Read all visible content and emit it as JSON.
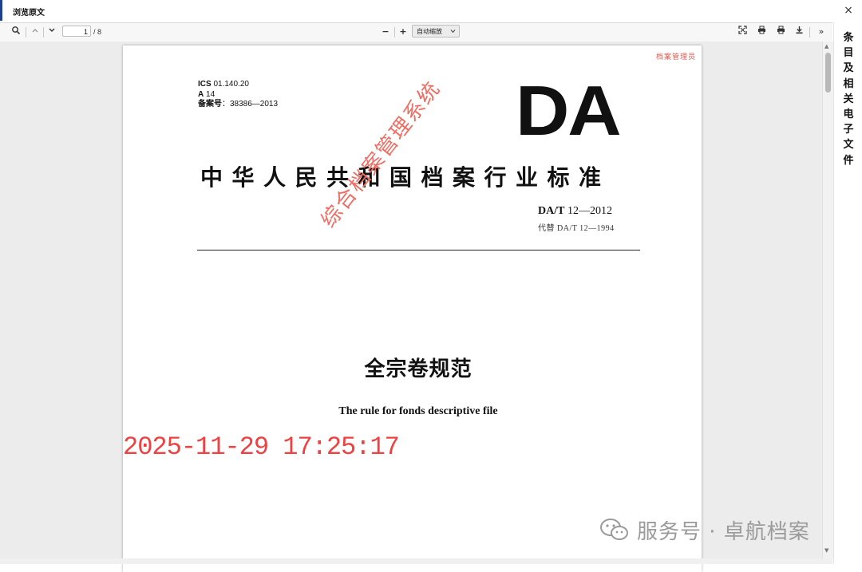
{
  "window": {
    "title": "浏览原文",
    "close_glyph": "×"
  },
  "toolbar": {
    "page_current": "1",
    "page_total": "/ 8",
    "zoom_label": "自动缩放",
    "zoom_minus": "−",
    "zoom_plus": "+",
    "more_glyph": "»"
  },
  "side_panel": {
    "chars": [
      "条",
      "目",
      "及",
      "相",
      "关",
      "电",
      "子",
      "文",
      "件"
    ]
  },
  "document": {
    "corner_stamp": "档案管理员",
    "ics": "01.140.20",
    "ics_label": "ICS",
    "a_label": "A",
    "a_value": "14",
    "record_label": "备案号",
    "record_value": "：38386—2013",
    "logo": "DA",
    "standard_title": "中华人民共和国档案行业标准",
    "std_code": "DA/T",
    "std_number": "12—2012",
    "replaces": "代替 DA/T 12—1994",
    "diagonal_stamp": "综合档案管理系统",
    "title_cn": "全宗卷规范",
    "title_en": "The rule for fonds descriptive file",
    "timestamp": "2025-11-29 17:25:17"
  },
  "watermark": {
    "text": "服务号 · 卓航档案"
  }
}
